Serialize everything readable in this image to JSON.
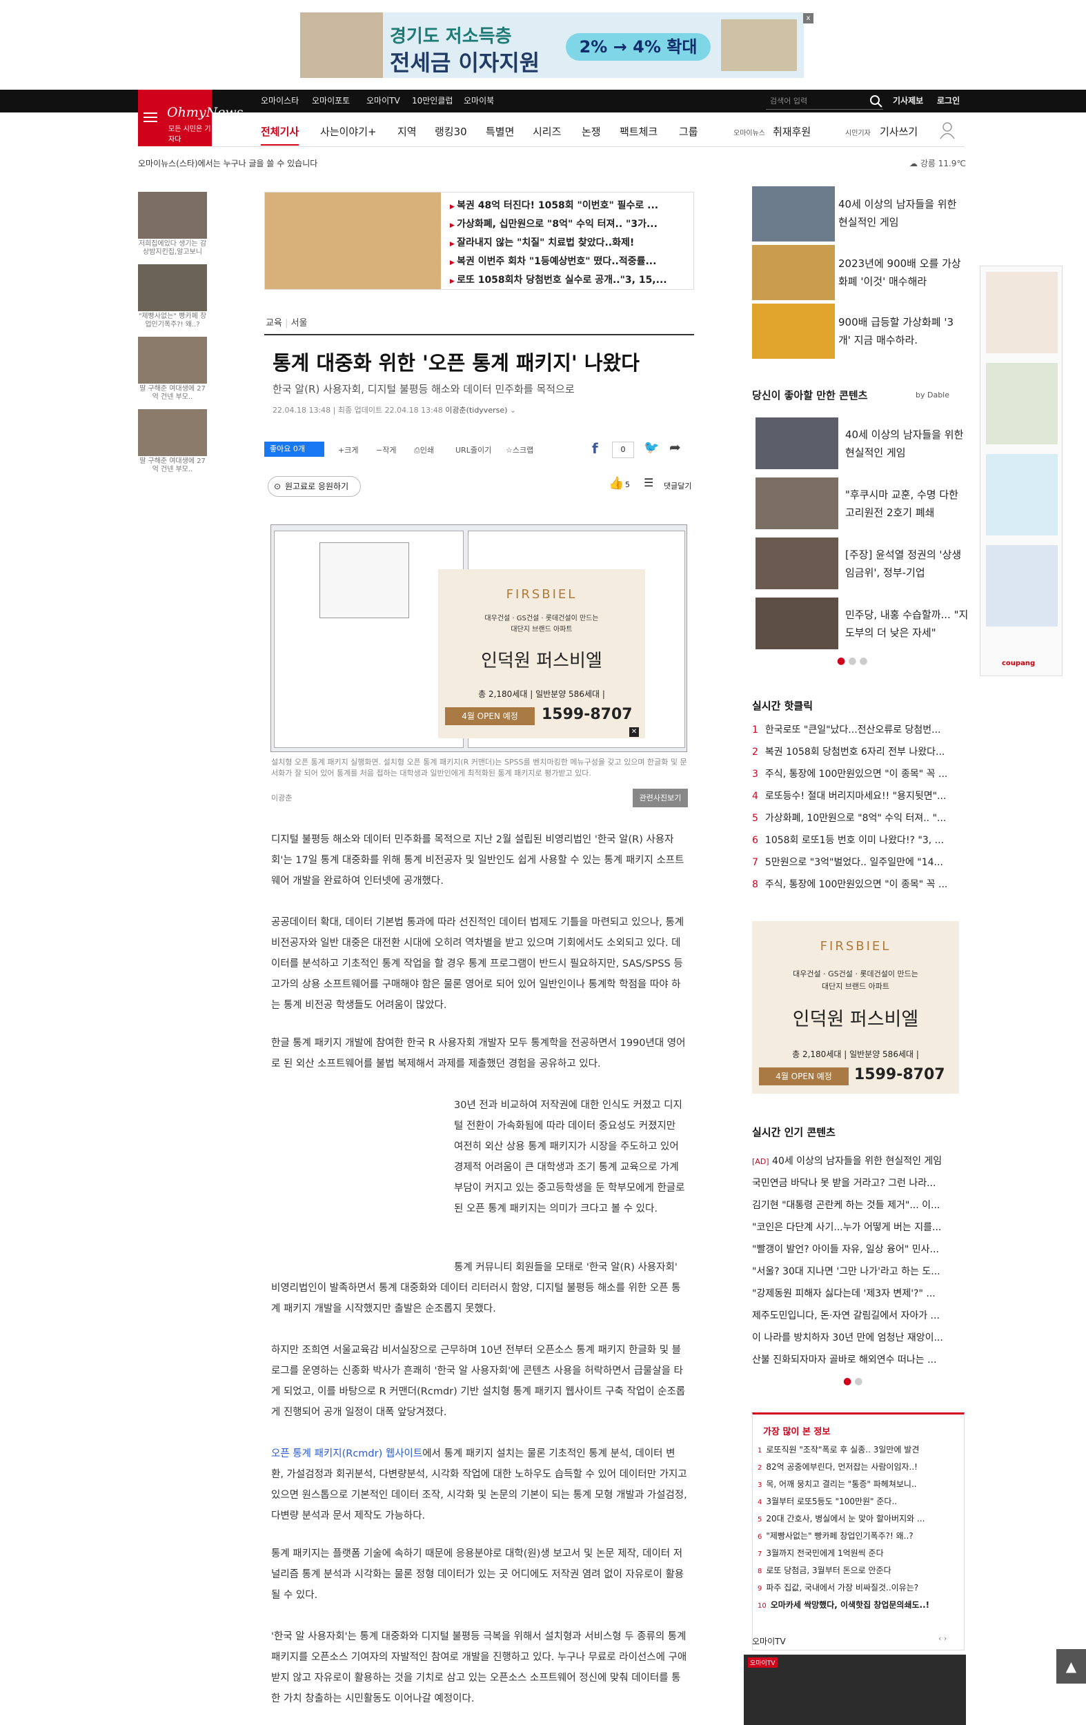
{
  "top_ad": {
    "line1": "경기도 저소득층",
    "line2": "전세금 이자지원",
    "pill": "2% → 4% 확대",
    "close": "x"
  },
  "header": {
    "sites": [
      "오마이스타",
      "오마이포토",
      "오마이TV",
      "10만인클럽",
      "오마이북"
    ],
    "search_placeholder": "검색어 입력",
    "report": "기사제보",
    "login": "로그인",
    "logo": "OhmyNews",
    "slogan": "모든 시민은 기자다",
    "nav": [
      "전체기사",
      "사는이야기+",
      "지역",
      "랭킹30",
      "특별면",
      "시리즈",
      "논쟁",
      "팩트체크",
      "그룹"
    ],
    "sponsor_small": "오마이뉴스",
    "sponsor": "취재후원",
    "reporter_small": "시민기자",
    "reporter": "기사쓰기"
  },
  "strip": "오마이뉴스(스타)에서는 누구나 글을 쓸 수 있습니다",
  "weather": "강릉 11.9℃",
  "left_items": [
    "저희집에있다 생기는 감상밤지킨집,알고보니",
    "\"제빵사없는\" 빵카페 창업인기폭주?! 왜..?",
    "딸 구해준 여대생에 27억 건넨 부모..",
    "딸 구해준 여대생에 27억 건넨 부모.."
  ],
  "inline_ad": [
    "복권 48억 터진다! 1058회 \"이번호\" 필수로 ...",
    "가상화폐, 십만원으로 \"8억\" 수익 터져.. \"3가...",
    "잘라내지 않는 \"치질\" 치료법 찾았다..화제!",
    "복권 이번주 회차 \"1등예상번호\" 떴다..적중률...",
    "로또 1058회차 당첨번호 실수로 공개..\"3, 15,..."
  ],
  "article": {
    "category": "교육",
    "region": "서울",
    "title": "통계 대중화 위한 '오픈 통계 패키지' 나왔다",
    "subtitle": "한국 알(R) 사용자회, 디지털 불평등 해소와 데이터 민주화를 목적으로",
    "date": "22.04.18 13:48",
    "updated": "최종 업데이트 22.04.18 13:48",
    "author": "이광춘(tidyverse)",
    "toolbar": {
      "like": "좋아요 0개",
      "big": "크게",
      "small": "작게",
      "print": "인쇄",
      "url": "URL줄이기",
      "scrap": "스크랩",
      "count": "0",
      "likes": "5",
      "comments": "댓글달기"
    },
    "cheer": "원고료로 응원하기",
    "caption": "설치형 오픈 통계 패키지 실행화면. 설치형 오픈 통계 패키지(R 커맨더)는 SPSS를 벤치마킹한 메뉴구성을 갖고 있으며 한글화 및 문서화가 잘 되어 있어 통계를 처음 접하는 대학생과 일반인에게 최적화된 통계 패키지로 평가받고 있다.",
    "credit": "이광춘",
    "related": "관련사진보기",
    "paragraphs": [
      "디지털 불평등 해소와 데이터 민주화를 목적으로 지난 2월 설립된 비영리법인 '한국 알(R) 사용자회'는 17일 통계 대중화를 위해 통계 비전공자 및 일반인도 쉽게 사용할 수 있는 통계 패키지 소프트웨어 개발을 완료하여 인터넷에 공개했다.",
      "공공데이터 확대, 데이터 기본법 통과에 따라 선진적인 데이터 법제도 기틀을 마련되고 있으나, 통계 비전공자와 일반 대중은 대전환 시대에 오히려 역차별을 받고 있으며 기회에서도 소외되고 있다. 데이터를 분석하고 기초적인 통계 작업을 할 경우 통계 프로그램이 반드시 필요하지만, SAS/SPSS 등 고가의 상용 소프트웨어를 구매해야 함은 물론 영어로 되어 있어 일반인이나 통계학 학점을 따야 하는 통계 비전공 학생들도 어려움이 많았다.",
      "한글 통계 패키지 개발에 참여한 한국 R 사용자회 개발자 모두 통계학을 전공하면서 1990년대 영어로 된 외산 소프트웨어를 불법 복제해서 과제를 제출했던 경험을 공유하고 있다.",
      "30년 전과 비교하여 저작권에 대한 인식도 커졌고 디지털 전환이 가속화됨에 따라 데이터 중요성도 커졌지만 여전히 외산 상용 통계 패키지가 시장을 주도하고 있어 경제적 어려움이 큰 대학생과 조기 통계 교육으로 가계 부담이 커지고 있는 중고등학생을 둔 학부모에게 한글로 된 오픈 통계 패키지는 의미가 크다고 볼 수 있다.",
      "통계 커뮤니티 회원들을 모태로 '한국 알(R) 사용자회' 비영리법인이 발족하면서 통계 대중화와 데이터 리터러시 함양, 디지털 불평등 해소를 위한 오픈 통계 패키지 개발을 시작했지만 출발은 순조롭지 못했다.",
      "하지만 조희연 서울교육감 비서실장으로 근무하며 10년 전부터 오픈소스 통계 패키지 한글화 및 블로그를 운영하는 신종화 박사가 흔쾌히 '한국 알 사용자회'에 콘텐츠 사용을 허락하면서 급물살을 타게 되었고, 이를 바탕으로 R 커맨더(Rcmdr) 기반 설치형 통계 패키지 웹사이트 구축 작업이 순조롭게 진행되어 공개 일정이 대폭 앞당겨졌다.",
      "에서 통계 패키지 설치는 물론 기초적인 통계 분석, 데이터 변환, 가설검정과 회귀분석, 다변량분석, 시각화 작업에 대한 노하우도 습득할 수 있어 데이터만 가지고 있으면 원스톱으로 기본적인 데이터 조작, 시각화 및 논문의 기본이 되는 통계 모형 개발과 가설검정, 다변량 분석과 문서 제작도 가능하다.",
      "통계 패키지는 플랫폼 기술에 속하기 때문에 응용분야로 대학(원)생 보고서 및 논문 제작, 데이터 저널리즘 통계 분석과 시각화는 물론 정형 데이터가 있는 곳 어디에도 저작권 염려 없이 자유로이 활용될 수 있다.",
      "'한국 알 사용자회'는 통계 대중화와 디지털 불평등 극복을 위해서 설치형과 서비스형 두 종류의 통계 패키지를 오픈소스 기여자의 자발적인 참여로 개발을 진행하고 있다. 누구나 무료로 라이선스에 구애받지 않고 자유로이 활용하는 것을 기치로 삼고 있는 오픈소스 소프트웨어 정신에 맞춰 데이터를 통한 가치 창출하는 시민활동도 이어나갈 예정이다."
    ],
    "link_text": "오픈 통계 패키지(Rcmdr) 웹사이트"
  },
  "firsbiel": {
    "brand": "FIRSBIEL",
    "sub1": "대우건설 · GS건설 · 롯데건설이 만드는",
    "sub2": "대단지 브랜드 아파트",
    "name": "인덕원 퍼스비엘",
    "stats": "총 2,180세대 | 일반분양 586세대 |",
    "open": "4월 OPEN 예정",
    "phone": "1599-8707"
  },
  "right_top": [
    "40세 이상의 남자들을 위한 현실적인 게임",
    "2023년에 900배 오를 가상화폐 '이것' 매수해라",
    "900배 급등할 가상화폐 '3개' 지금 매수하라."
  ],
  "dable": {
    "title": "당신이 좋아할 만한 콘텐츠",
    "by": "by Dable",
    "items": [
      "40세 이상의 남자들을 위한 현실적인 게임",
      "\"후쿠시마 교훈, 수명 다한 고리원전 2호기 폐쇄",
      "[주장] 윤석열 정권의 '상생임금위', 정부-기업",
      "민주당, 내홍 수습할까... \"지도부의 더 낮은 자세\""
    ]
  },
  "hot_click": {
    "title": "실시간 핫클릭",
    "items": [
      "한국로또 \"큰일\"났다...전산오류로 당첨번...",
      "복권 1058회 당첨번호 6자리 전부 나왔다...",
      "주식, 통장에 100만원있으면 \"이 종목\" 꼭 ...",
      "로또등수! 절대 버리지마세요!! \"용지뒷면\"...",
      "가상화폐, 10만원으로 \"8억\" 수익 터져.. \"...",
      "1058회 로또1등 번호 이미 나왔다!? \"3, ...",
      "5만원으로 \"3억\"벌었다.. 일주일만에 \"14...",
      "주식, 통장에 100만원있으면 \"이 종목\" 꼭 ..."
    ]
  },
  "popular": {
    "title": "실시간 인기 콘텐츠",
    "ad_tag": "[AD]",
    "items": [
      "40세 이상의 남자들을 위한 현실적인 게임",
      "국민연금 바닥나 못 받을 거라고? 그런 나라...",
      "김기현 \"대통령 곤란케 하는 것들 제거\"... 이...",
      "\"코인은 다단계 사기...누가 어떻게 버는 지를...",
      "\"빨갱이 발언? 아이들 자유, 일상 융어\" 민사...",
      "\"서울? 30대 지나면 '그만 나가'라고 하는 도...",
      "\"강제동원 피해자 싫다는데 '제3자 변제'?\" ...",
      "제주도민입니다, 돈·자연 갈림길에서 자아가 ...",
      "이 나라를 방치하자 30년 만에 엄청난 재앙이...",
      "산불 진화되자마자 골바로 해외연수 떠나는 ..."
    ]
  },
  "most_viewed": {
    "title": "가장 많이 본 정보",
    "items": [
      "로또직원 \"조작\"폭로 후 실종.. 3일만에 발견",
      "82억 공중에부린다, 먼저잡는 사람이임자..!",
      "목, 어깨 뭉치고 결리는 \"통증\" 파헤쳐보니..",
      "3월부터 로또5등도 \"100만원\" 준다..",
      "20대 간호사, 병실에서 눈 맞아 할아버지와 ...",
      "\"제빵사없는\" 빵카페 창업인기폭주?! 왜..?",
      "3월까지 전국민에게 1억원씩 준다",
      "로또 당첨금, 3월부터 돈으로 안준다",
      "파주 집값, 국내에서 가장 비싸질것..이유는?",
      "오마카세 싹망했다, 이색핫집 창업문의쇄도..!"
    ]
  },
  "tv": {
    "title": "오마이TV",
    "label": "오마이TV"
  },
  "coupang": "coupang",
  "totop": "▲"
}
